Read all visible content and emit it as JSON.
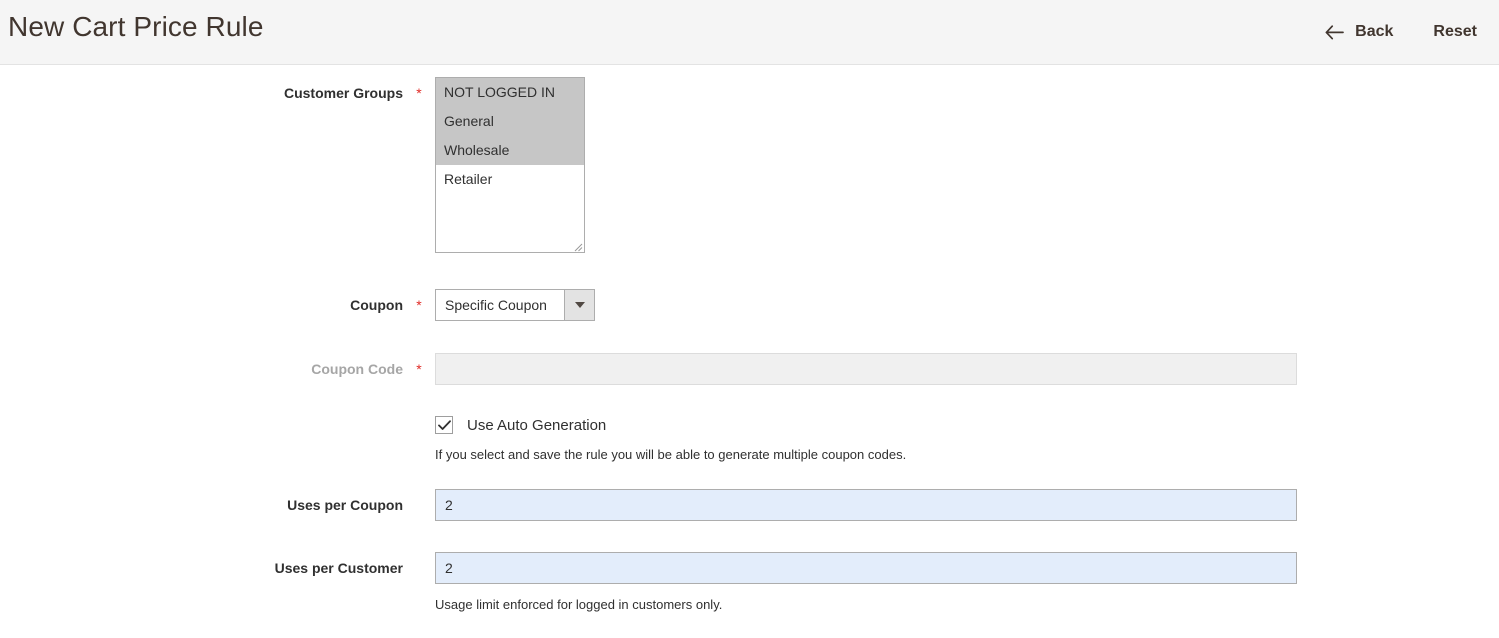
{
  "header": {
    "title": "New Cart Price Rule",
    "back_label": "Back",
    "back_icon": "arrow-left-icon",
    "reset_label": "Reset"
  },
  "form": {
    "customer_groups": {
      "label": "Customer Groups",
      "required_marker": "*",
      "options": [
        {
          "label": "NOT LOGGED IN",
          "selected": true
        },
        {
          "label": "General",
          "selected": true
        },
        {
          "label": "Wholesale",
          "selected": true
        },
        {
          "label": "Retailer",
          "selected": false
        }
      ]
    },
    "coupon": {
      "label": "Coupon",
      "required_marker": "*",
      "value": "Specific Coupon",
      "dropdown_icon": "chevron-down-icon"
    },
    "coupon_code": {
      "label": "Coupon Code",
      "required_marker": "*",
      "value": "",
      "placeholder": "",
      "disabled": true
    },
    "auto_generation": {
      "label": "Use Auto Generation",
      "checked": true,
      "check_icon": "checkmark-icon",
      "note": "If you select and save the rule you will be able to generate multiple coupon codes."
    },
    "uses_per_coupon": {
      "label": "Uses per Coupon",
      "value": "2"
    },
    "uses_per_customer": {
      "label": "Uses per Customer",
      "value": "2",
      "note": "Usage limit enforced for logged in customers only."
    }
  },
  "colors": {
    "header_bg": "#f5f5f5",
    "required": "#e02b27",
    "selected_option": "#c6c6c6",
    "autofill": "#e3edfb",
    "disabled_field": "#f0f0f0"
  }
}
